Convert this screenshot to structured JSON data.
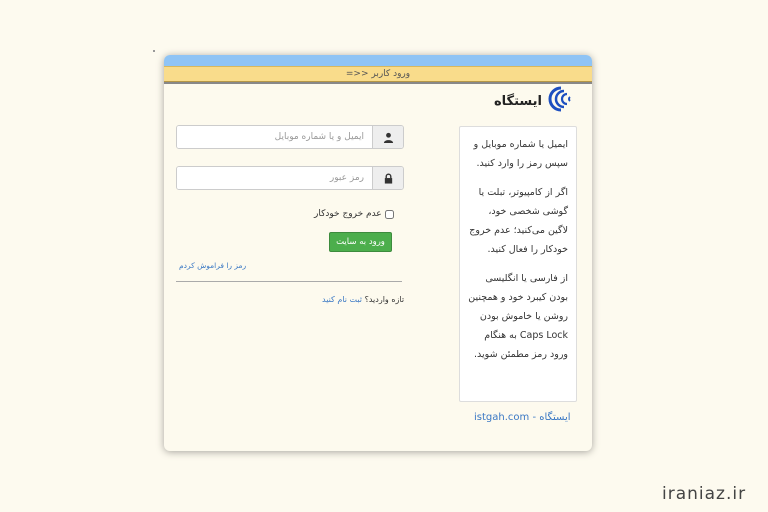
{
  "header": {
    "title": "ورود کاربر <<="
  },
  "brand": {
    "name": "ایستگاه",
    "logo_icon": "istgah-logo-icon",
    "logo_color": "#1d4fc0"
  },
  "info": {
    "paragraphs": [
      "ایمیل یا شماره موبایل و سپس رمز را وارد کنید.",
      "اگر از کامپیوتر، تبلت یا گوشی شخصی خود، لاگین می‌کنید؛ عدم خروج خودکار را فعال کنید.",
      "از فارسی یا انگلیسی بودن کیبرد خود و همچنین روشن یا خاموش بودن Caps Lock به هنگام ورود رمز مطمئن شوید."
    ]
  },
  "footer": {
    "site_link": "ایستگاه - istgah.com"
  },
  "form": {
    "username_placeholder": "ایمیل و یا شماره موبایل",
    "username_value": "",
    "username_icon": "user-icon",
    "password_placeholder": "رمز عبور",
    "password_value": "",
    "password_icon": "lock-icon",
    "remember_label": "عدم خروج خودکار",
    "remember_checked": false,
    "submit_label": "ورود به سایت",
    "forgot_label": "رمز را فراموش کردم",
    "signup_prefix": "تازه واردید؟",
    "signup_link": "ثبت نام کنید"
  },
  "colors": {
    "accent_blue": "#8fc4f5",
    "header_yellow": "#f9dc8b",
    "button_green": "#4cae4c",
    "link_blue": "#3a78c4"
  },
  "watermark": {
    "text": "iraniaz.ir"
  }
}
